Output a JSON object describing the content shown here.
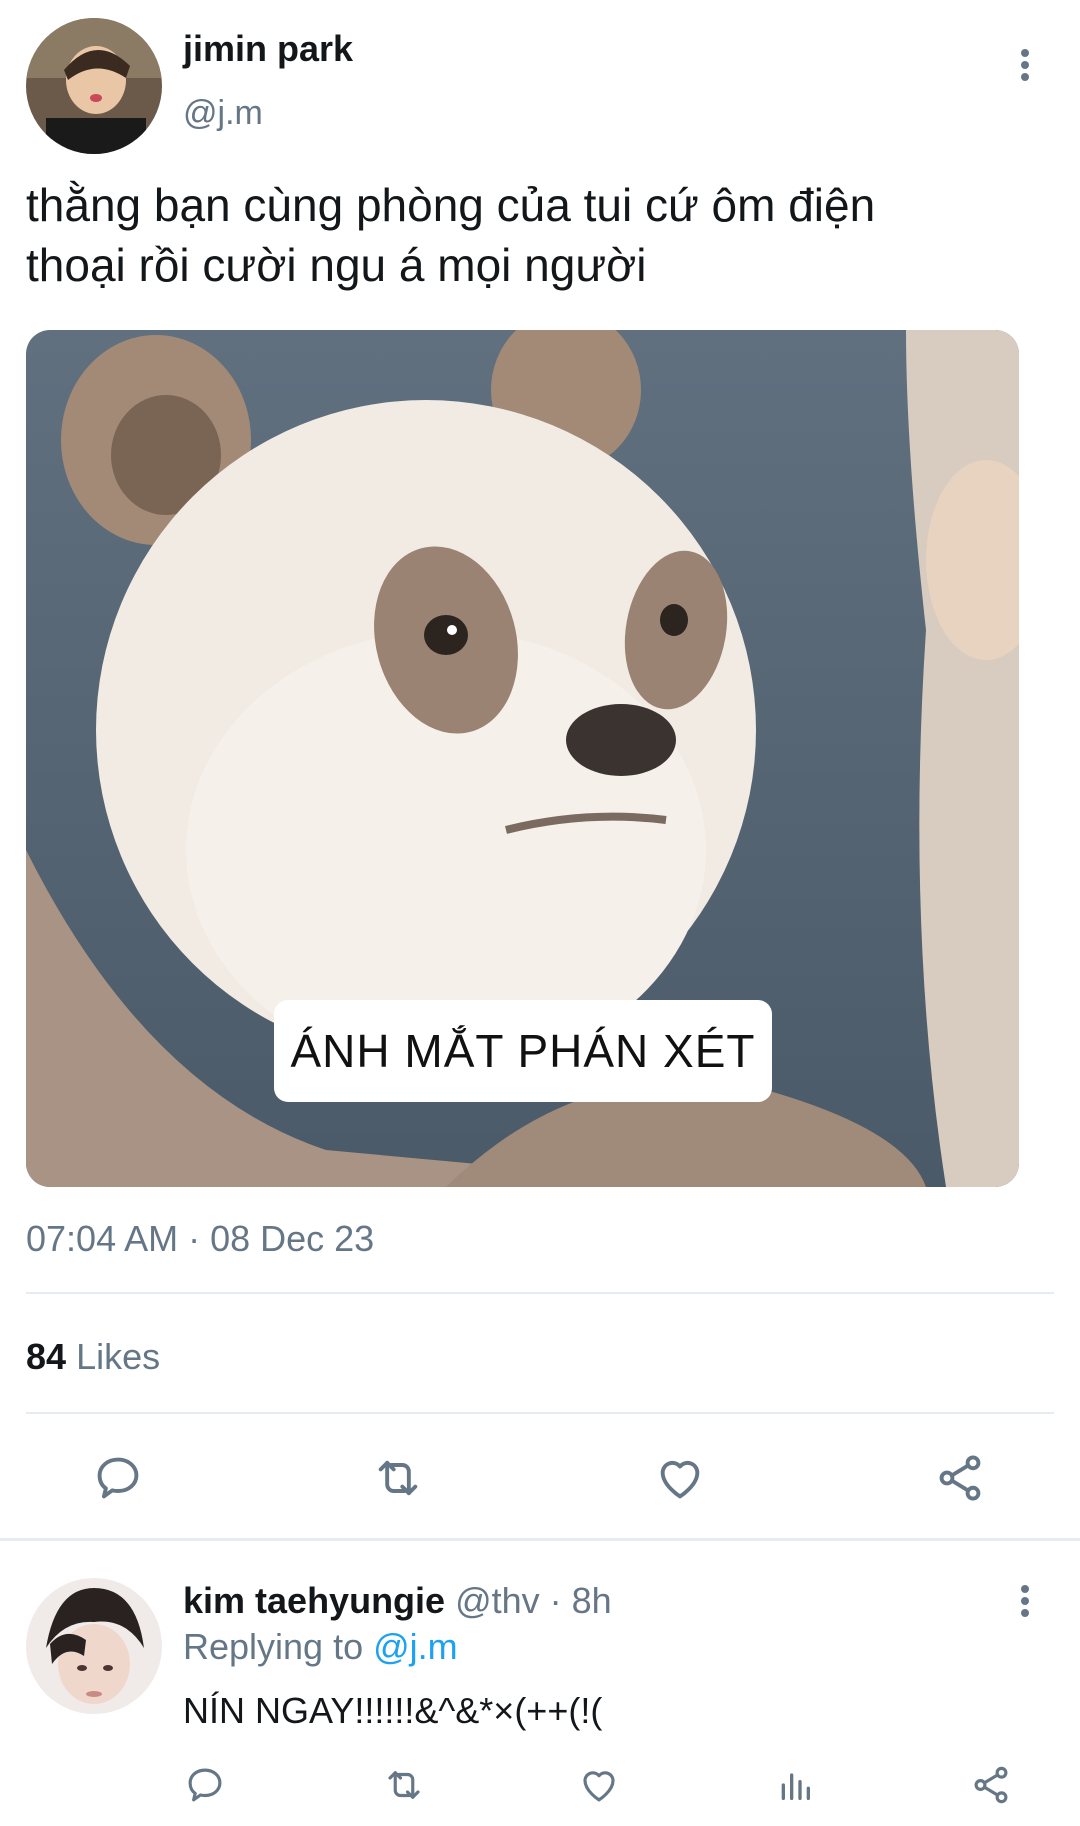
{
  "tweet": {
    "author_name": "jimin park",
    "author_handle": "@j.m",
    "text_line1": "thằng bạn cùng phòng của tui cứ ôm điện",
    "text_line2": "thoại rồi cười ngu á mọi người",
    "image_caption": "ÁNH MẮT PHÁN XÉT",
    "timestamp": "07:04 AM · 08 Dec 23",
    "likes_count": "84",
    "likes_label": "Likes"
  },
  "reply": {
    "author_name": "kim taehyungie",
    "meta": "@thv · 8h",
    "replying_prefix": "Replying to",
    "replying_handle": "@j.m",
    "text": "NÍN NGAY!!!!!!&^&*×(++(!("
  },
  "colors": {
    "accent": "#1da1f2",
    "muted": "#657786",
    "divider": "#e6ecf0"
  },
  "icons": [
    "more-icon",
    "reply-icon",
    "retweet-icon",
    "like-icon",
    "share-icon",
    "analytics-icon"
  ]
}
